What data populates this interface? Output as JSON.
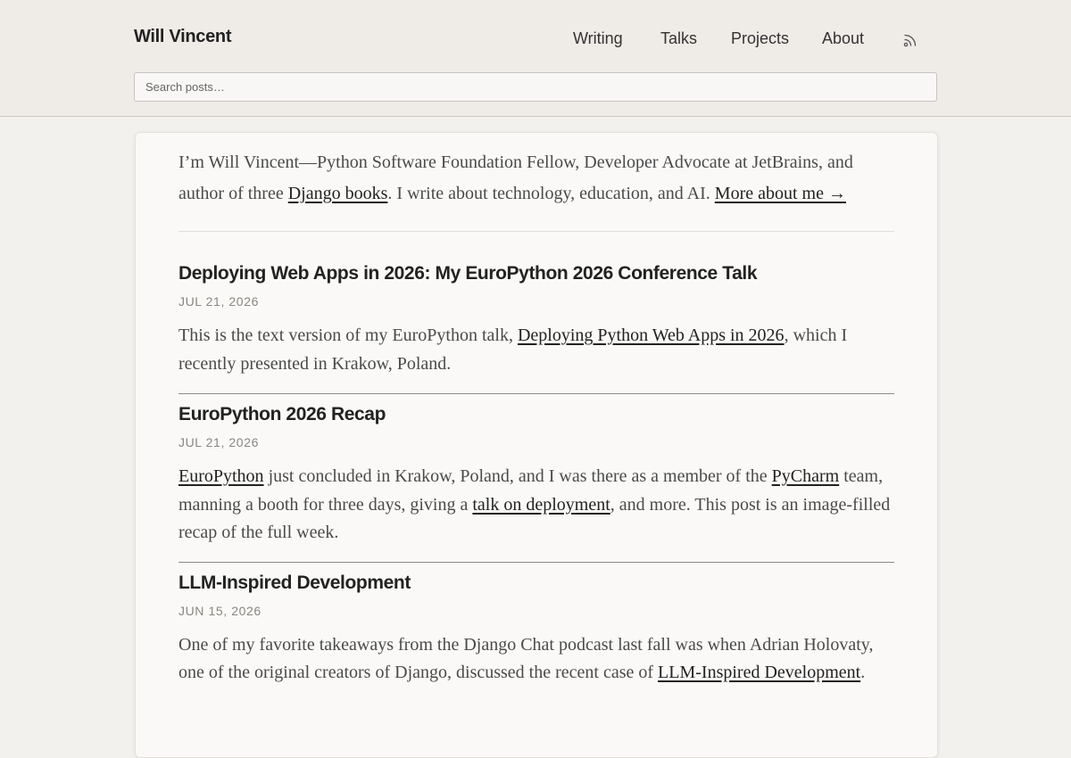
{
  "header": {
    "site_title": "Will Vincent",
    "nav": [
      {
        "label": "Writing"
      },
      {
        "label": "Talks"
      },
      {
        "label": "Projects"
      },
      {
        "label": "About"
      }
    ],
    "rss_icon": "rss-icon",
    "search": {
      "placeholder": "Search posts…",
      "value": ""
    }
  },
  "intro": {
    "text_1": "I’m Will Vincent—Python Software Foundation Fellow, Developer Advocate at JetBrains, and author of three ",
    "link_books": "Django books",
    "text_2": ". I write about technology, education, and AI. ",
    "link_more": "More about me →"
  },
  "posts": [
    {
      "title": "Deploying Web Apps in 2026: My EuroPython 2026 Conference Talk",
      "date": "JUL 21, 2026",
      "body": {
        "t1": "This is the text version of my EuroPython talk, ",
        "l1": "Deploying Python Web Apps in 2026",
        "t2": ", which I recently presented in Krakow, Poland."
      }
    },
    {
      "title": "EuroPython 2026 Recap",
      "date": "JUL 21, 2026",
      "body": {
        "l1": "EuroPython",
        "t1": " just concluded in Krakow, Poland, and I was there as a member of the ",
        "l2": "PyCharm",
        "t2": " team, manning a booth for three days, giving a ",
        "l3": "talk on deployment",
        "t3": ", and more. This post is an image-filled recap of the full week."
      }
    },
    {
      "title": "LLM-Inspired Development",
      "date": "JUN 15, 2026",
      "body": {
        "t1": "One of my favorite takeaways from the Django Chat podcast last fall was when Adrian Holovaty, one of the original creators of Django, discussed the recent case of ",
        "l1": "LLM-Inspired Development",
        "t2": "."
      }
    }
  ]
}
